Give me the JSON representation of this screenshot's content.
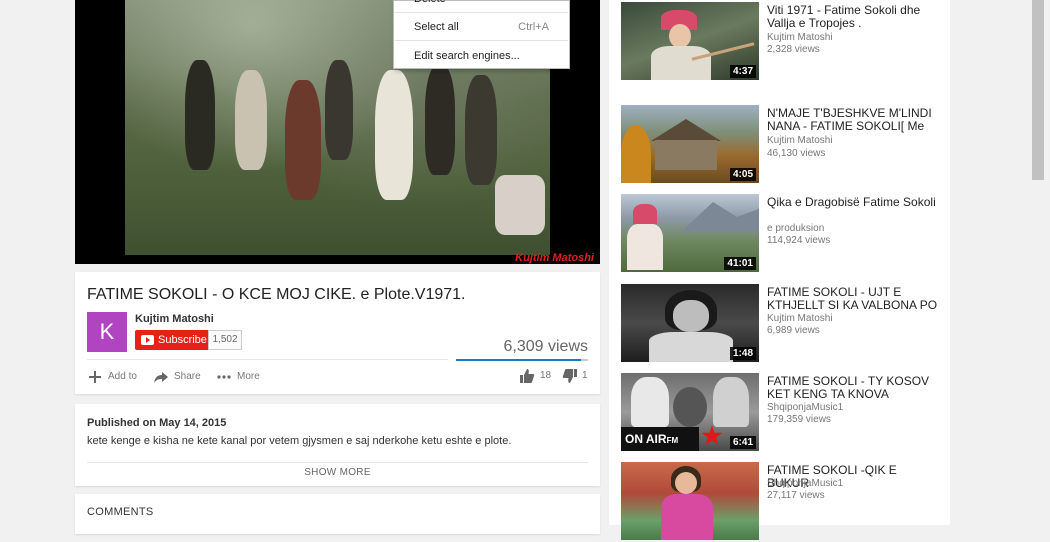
{
  "player": {
    "watermark": "Kujtim Matoshi"
  },
  "context_menu": {
    "items": [
      {
        "label": "Delete",
        "shortcut": ""
      },
      {
        "label": "Select all",
        "shortcut": "Ctrl+A"
      },
      {
        "label": "Edit search engines...",
        "shortcut": ""
      }
    ]
  },
  "video": {
    "title": "FATIME SOKOLI - O KCE MOJ CIKE. e Plote.V1971.",
    "channel": "Kujtim Matoshi",
    "avatar_letter": "K",
    "avatar_color": "#b145c1",
    "subscribe_label": "Subscribe",
    "subscriber_count": "1,502",
    "views": "6,309 views",
    "likes": "18",
    "dislikes": "1",
    "like_ratio": 0.95,
    "actions": {
      "add_to": "Add to",
      "share": "Share",
      "more": "More"
    }
  },
  "description": {
    "published": "Published on May 14, 2015",
    "text": "kete kenge e kisha ne kete kanal por vetem gjysmen e saj nderkohe ketu eshte e plote.",
    "show_more": "SHOW MORE"
  },
  "comments": {
    "heading": "COMMENTS"
  },
  "recommendations": [
    {
      "title": "Viti 1971 - Fatime Sokoli dhe Vallja e Tropojes .",
      "channel": "Kujtim Matoshi",
      "views": "2,328 views",
      "duration": "4:37"
    },
    {
      "title": "N'MAJE T'BJESHKVE M'LINDI NANA - FATIME SOKOLI[ Me",
      "channel": "Kujtim Matoshi",
      "views": "46,130 views",
      "duration": "4:05"
    },
    {
      "title": "Qika e Dragobisë Fatime Sokoli",
      "channel": "e produksion",
      "views": "114,924 views",
      "duration": "41:01"
    },
    {
      "title": "FATIME SOKOLI - UJT E KTHJELLT SI KA VALBONA PO",
      "channel": "Kujtim Matoshi",
      "views": "6,989 views",
      "duration": "1:48"
    },
    {
      "title": "FATIME SOKOLI - TY KOSOV KET KENG TA KNOVA",
      "channel": "ShqiponjaMusic1",
      "views": "179,359 views",
      "duration": "6:41"
    },
    {
      "title": "FATIME SOKOLI -QIK E BUKUR",
      "channel": "ShqiponjaMusic1",
      "views": "27,117 views",
      "duration": ""
    }
  ],
  "thumb_overlays": {
    "on_air": "ON AIR",
    "fm": "FM"
  },
  "colors": {
    "subscribe": "#e62117",
    "like_bar": "#167ac6"
  }
}
